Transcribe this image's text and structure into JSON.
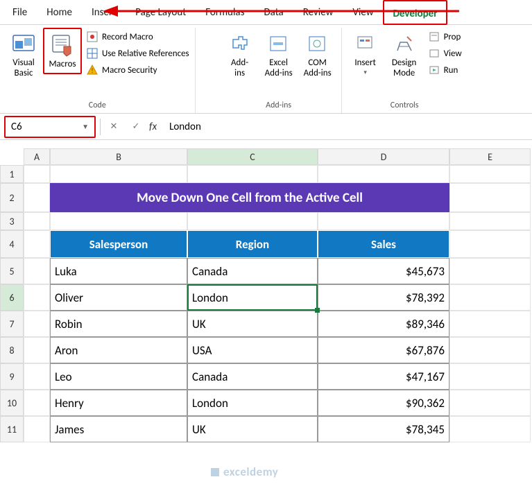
{
  "tabs": {
    "file": "File",
    "home": "Home",
    "insert": "Insert",
    "pageLayout": "Page Layout",
    "formulas": "Formulas",
    "data": "Data",
    "review": "Review",
    "view": "View",
    "developer": "Developer"
  },
  "ribbon": {
    "code": {
      "visualBasic": "Visual\nBasic",
      "macros": "Macros",
      "recordMacro": "Record Macro",
      "useRelRef": "Use Relative References",
      "macroSecurity": "Macro Security",
      "label": "Code"
    },
    "addins": {
      "addins": "Add-\nins",
      "excel": "Excel\nAdd-ins",
      "com": "COM\nAdd-ins",
      "label": "Add-ins"
    },
    "controls": {
      "insert": "Insert",
      "design": "Design\nMode",
      "prop": "Prop",
      "view": "View",
      "run": "Run",
      "label": "Controls"
    }
  },
  "nameBox": "C6",
  "formula": "London",
  "cols": {
    "A": "A",
    "B": "B",
    "C": "C",
    "D": "D",
    "E": "E"
  },
  "rows": [
    "1",
    "2",
    "3",
    "4",
    "5",
    "6",
    "7",
    "8",
    "9",
    "10",
    "11"
  ],
  "title": "Move Down One Cell from the Active Cell",
  "headers": {
    "salesperson": "Salesperson",
    "region": "Region",
    "sales": "Sales"
  },
  "chart_data": {
    "type": "table",
    "columns": [
      "Salesperson",
      "Region",
      "Sales"
    ],
    "rows": [
      {
        "salesperson": "Luka",
        "region": "Canada",
        "sales": "$45,673"
      },
      {
        "salesperson": "Oliver",
        "region": "London",
        "sales": "$78,392"
      },
      {
        "salesperson": "Robin",
        "region": "UK",
        "sales": "$89,346"
      },
      {
        "salesperson": "Aron",
        "region": "USA",
        "sales": "$67,876"
      },
      {
        "salesperson": "Leo",
        "region": "Canada",
        "sales": "$47,167"
      },
      {
        "salesperson": "Henry",
        "region": "London",
        "sales": "$90,362"
      },
      {
        "salesperson": "James",
        "region": "UK",
        "sales": "$78,345"
      }
    ]
  },
  "watermark": "exceldemy"
}
